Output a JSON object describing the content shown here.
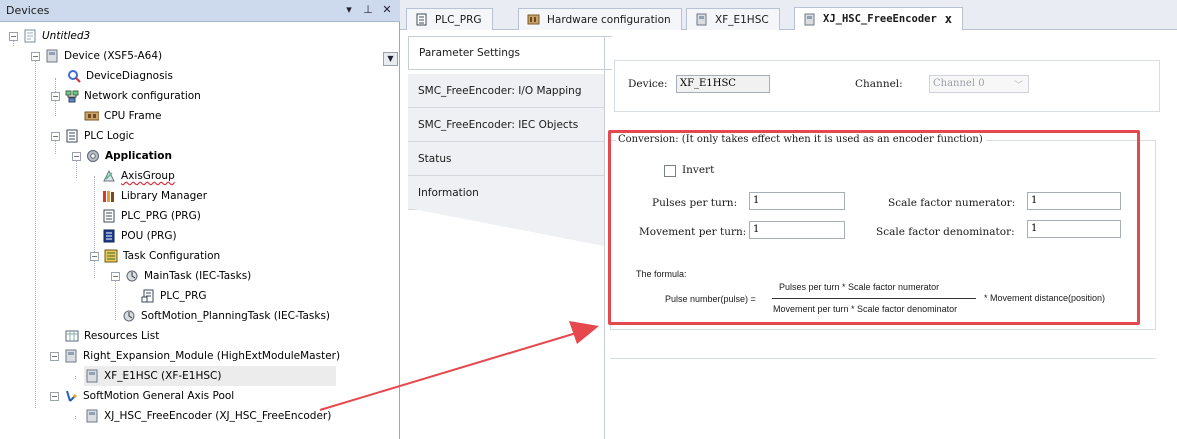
{
  "devices_panel": {
    "title": "Devices",
    "dropdown_glyph": "▾",
    "pin_glyph": "⊥",
    "close_glyph": "✕",
    "tree": [
      {
        "label": "Untitled3",
        "icon": "project-icon"
      },
      {
        "label": "Device (XSF5-A64)",
        "icon": "device-icon"
      },
      {
        "label": "DeviceDiagnosis",
        "icon": "diagnosis-icon"
      },
      {
        "label": "Network configuration",
        "icon": "network-icon"
      },
      {
        "label": "CPU Frame",
        "icon": "cpu-frame-icon"
      },
      {
        "label": "PLC Logic",
        "icon": "plc-logic-icon"
      },
      {
        "label": "Application",
        "icon": "application-icon"
      },
      {
        "label": "AxisGroup",
        "icon": "axisgroup-icon"
      },
      {
        "label": "Library Manager",
        "icon": "library-icon"
      },
      {
        "label": "PLC_PRG (PRG)",
        "icon": "program-icon"
      },
      {
        "label": "POU (PRG)",
        "icon": "pou-icon"
      },
      {
        "label": "Task Configuration",
        "icon": "task-config-icon"
      },
      {
        "label": "MainTask (IEC-Tasks)",
        "icon": "task-icon"
      },
      {
        "label": "PLC_PRG",
        "icon": "program-call-icon"
      },
      {
        "label": "SoftMotion_PlanningTask (IEC-Tasks)",
        "icon": "task-icon"
      },
      {
        "label": "Resources List",
        "icon": "resources-icon"
      },
      {
        "label": "Right_Expansion_Module (HighExtModuleMaster)",
        "icon": "module-icon"
      },
      {
        "label": "XF_E1HSC (XF-E1HSC)",
        "icon": "module-icon"
      },
      {
        "label": "SoftMotion General Axis Pool",
        "icon": "axis-pool-icon"
      },
      {
        "label": "XJ_HSC_FreeEncoder (XJ_HSC_FreeEncoder)",
        "icon": "encoder-icon"
      }
    ]
  },
  "editor_tabs": [
    {
      "label": "PLC_PRG"
    },
    {
      "label": "Hardware configuration"
    },
    {
      "label": "XF_E1HSC"
    },
    {
      "label": "XJ_HSC_FreeEncoder"
    }
  ],
  "tab_close_glyph": "x",
  "side_tabs": [
    {
      "label": "Parameter Settings"
    },
    {
      "label": "SMC_FreeEncoder: I/O Mapping"
    },
    {
      "label": "SMC_FreeEncoder: IEC Objects"
    },
    {
      "label": "Status"
    },
    {
      "label": "Information"
    }
  ],
  "device_section": {
    "device_label": "Device:",
    "device_value": "XF_E1HSC",
    "channel_label": "Channel:",
    "channel_value": "Channel 0",
    "chevron": "﹀"
  },
  "conversion": {
    "title": "Conversion: (It only takes effect when it is used as an encoder function)",
    "invert_label": "Invert",
    "pulses_per_turn_label": "Pulses per turn:",
    "pulses_per_turn_value": "1",
    "movement_per_turn_label": "Movement per turn:",
    "movement_per_turn_value": "1",
    "scale_num_label": "Scale factor numerator:",
    "scale_num_value": "1",
    "scale_den_label": "Scale factor denominator:",
    "scale_den_value": "1",
    "formula_title": "The formula:",
    "formula_lhs": "Pulse number(pulse) =",
    "formula_numerator": "Pulses per turn * Scale factor numerator",
    "formula_denominator": "Movement per turn * Scale factor denominator",
    "formula_rhs": "* Movement distance(position)"
  },
  "colors": {
    "highlight": "#e5484d",
    "header_bg": "#cdd9ec"
  }
}
